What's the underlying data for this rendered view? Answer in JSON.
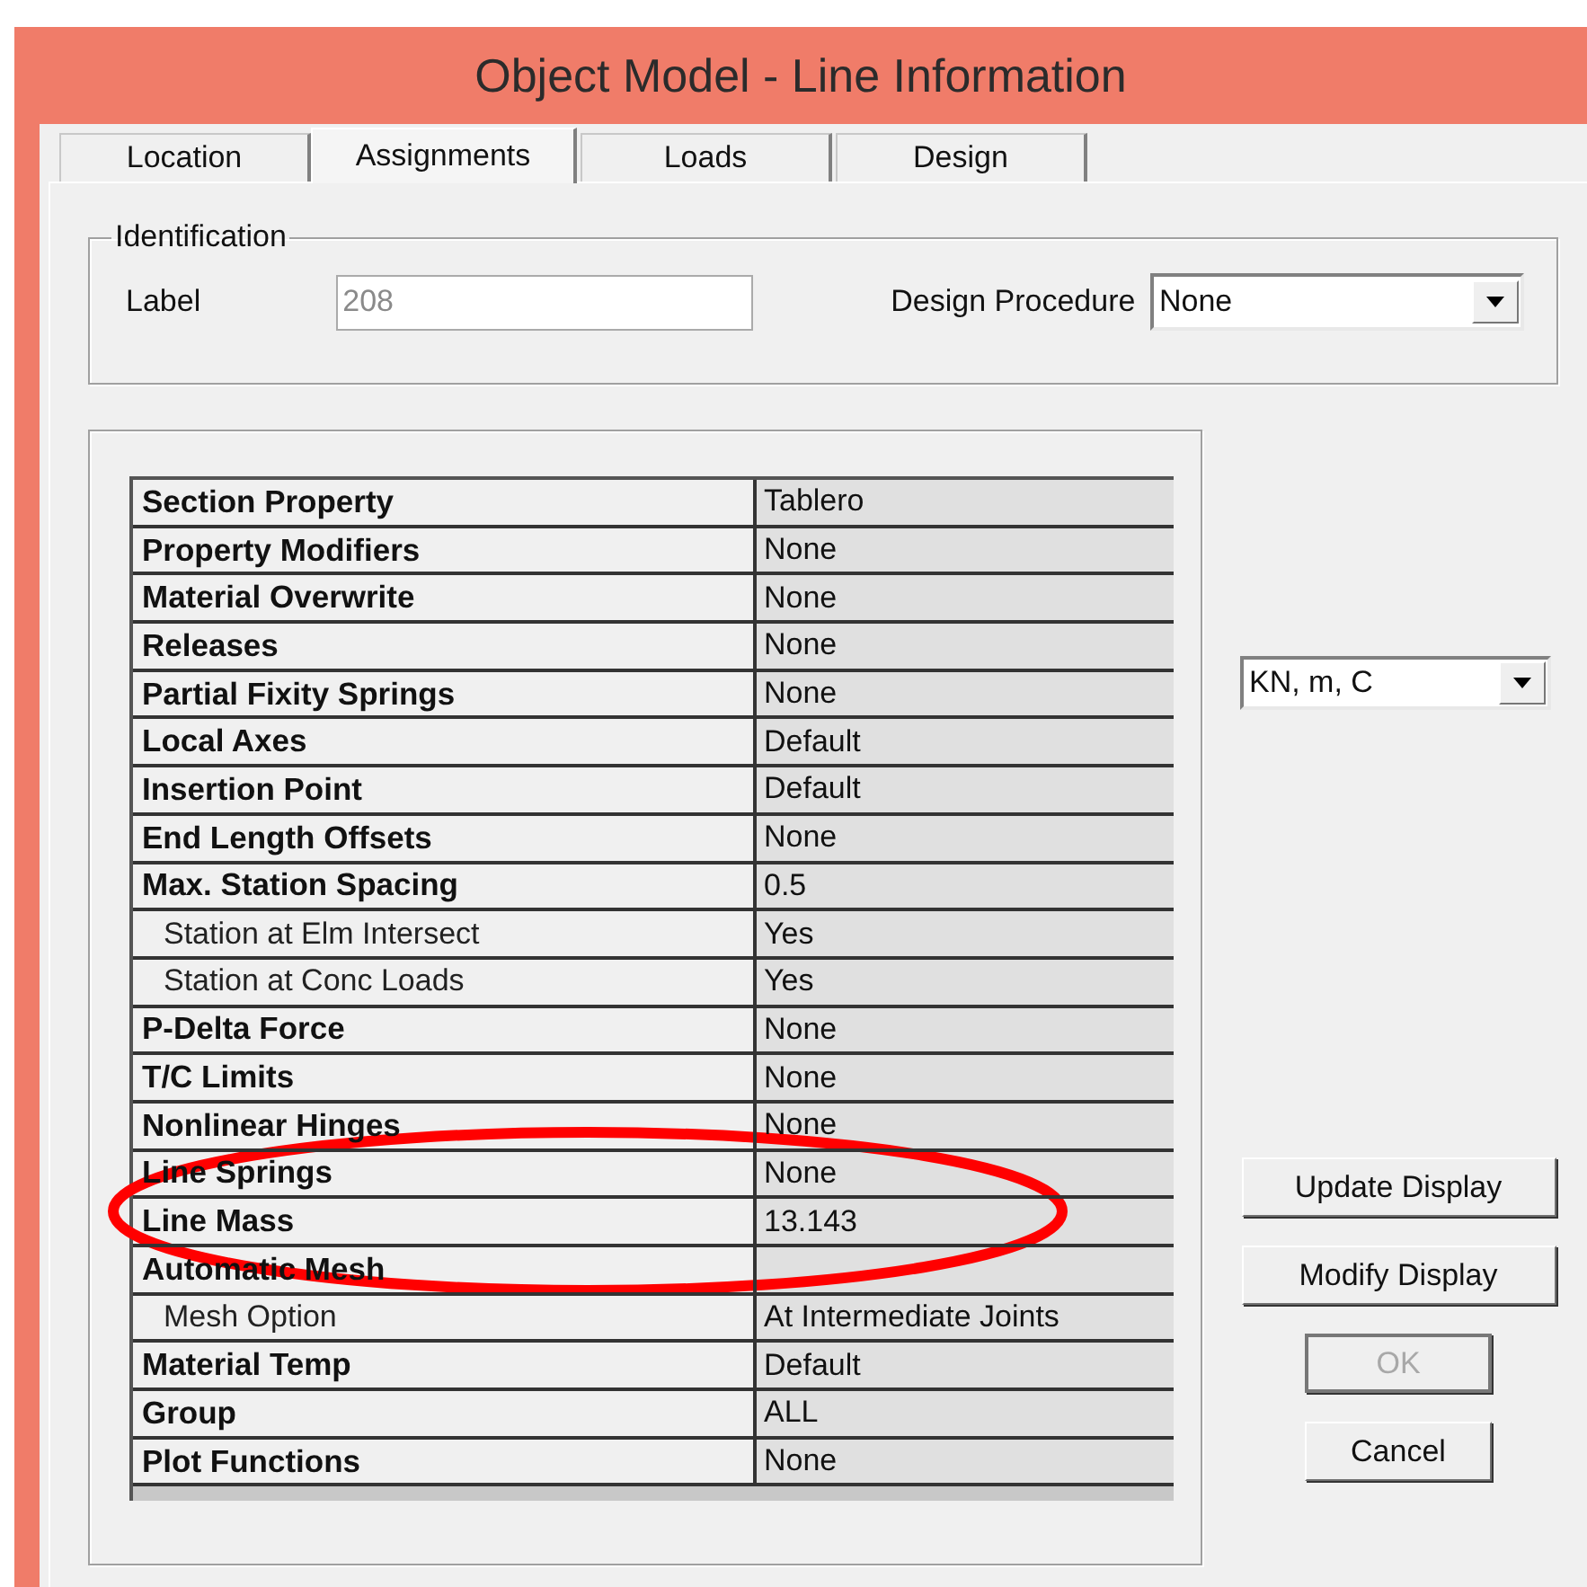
{
  "window": {
    "title": "Object Model - Line Information"
  },
  "tabs": [
    {
      "label": "Location",
      "selected": false
    },
    {
      "label": "Assignments",
      "selected": true
    },
    {
      "label": "Loads",
      "selected": false
    },
    {
      "label": "Design",
      "selected": false
    }
  ],
  "identification": {
    "legend": "Identification",
    "label_caption": "Label",
    "label_value": "208",
    "label_disabled": true,
    "procedure_caption": "Design Procedure",
    "procedure_value": "None"
  },
  "assignments": [
    {
      "kind": "main",
      "name": "Section Property",
      "value": "Tablero"
    },
    {
      "kind": "main",
      "name": "Property Modifiers",
      "value": "None"
    },
    {
      "kind": "main",
      "name": "Material Overwrite",
      "value": "None"
    },
    {
      "kind": "main",
      "name": "Releases",
      "value": "None"
    },
    {
      "kind": "main",
      "name": "Partial Fixity Springs",
      "value": "None"
    },
    {
      "kind": "main",
      "name": "Local Axes",
      "value": "Default"
    },
    {
      "kind": "main",
      "name": "Insertion Point",
      "value": "Default"
    },
    {
      "kind": "main",
      "name": "End Length Offsets",
      "value": "None"
    },
    {
      "kind": "main",
      "name": "Max. Station Spacing",
      "value": "0.5"
    },
    {
      "kind": "sub",
      "name": "Station at Elm Intersect",
      "value": "Yes"
    },
    {
      "kind": "sub",
      "name": "Station at Conc Loads",
      "value": "Yes"
    },
    {
      "kind": "main",
      "name": "P-Delta Force",
      "value": "None"
    },
    {
      "kind": "main",
      "name": "T/C Limits",
      "value": "None"
    },
    {
      "kind": "main",
      "name": "Nonlinear Hinges",
      "value": "None"
    },
    {
      "kind": "main",
      "name": "Line Springs",
      "value": "None"
    },
    {
      "kind": "main",
      "name": "Line Mass",
      "value": "13.143"
    },
    {
      "kind": "main",
      "name": "Automatic Mesh"
    },
    {
      "kind": "sub",
      "name": "Mesh Option",
      "value": "At Intermediate Joints"
    },
    {
      "kind": "main",
      "name": "Material Temp",
      "value": "Default"
    },
    {
      "kind": "main",
      "name": "Group",
      "value": "ALL"
    },
    {
      "kind": "main",
      "name": "Plot Functions",
      "value": "None"
    }
  ],
  "units": {
    "value": "KN, m, C"
  },
  "buttons": [
    {
      "label": "Update Display",
      "kind": "wide",
      "disabled": false
    },
    {
      "label": "Modify Display",
      "kind": "wide",
      "disabled": false
    },
    {
      "label": "OK",
      "kind": "narrow",
      "disabled": true
    },
    {
      "label": "Cancel",
      "kind": "narrow",
      "disabled": false
    }
  ]
}
